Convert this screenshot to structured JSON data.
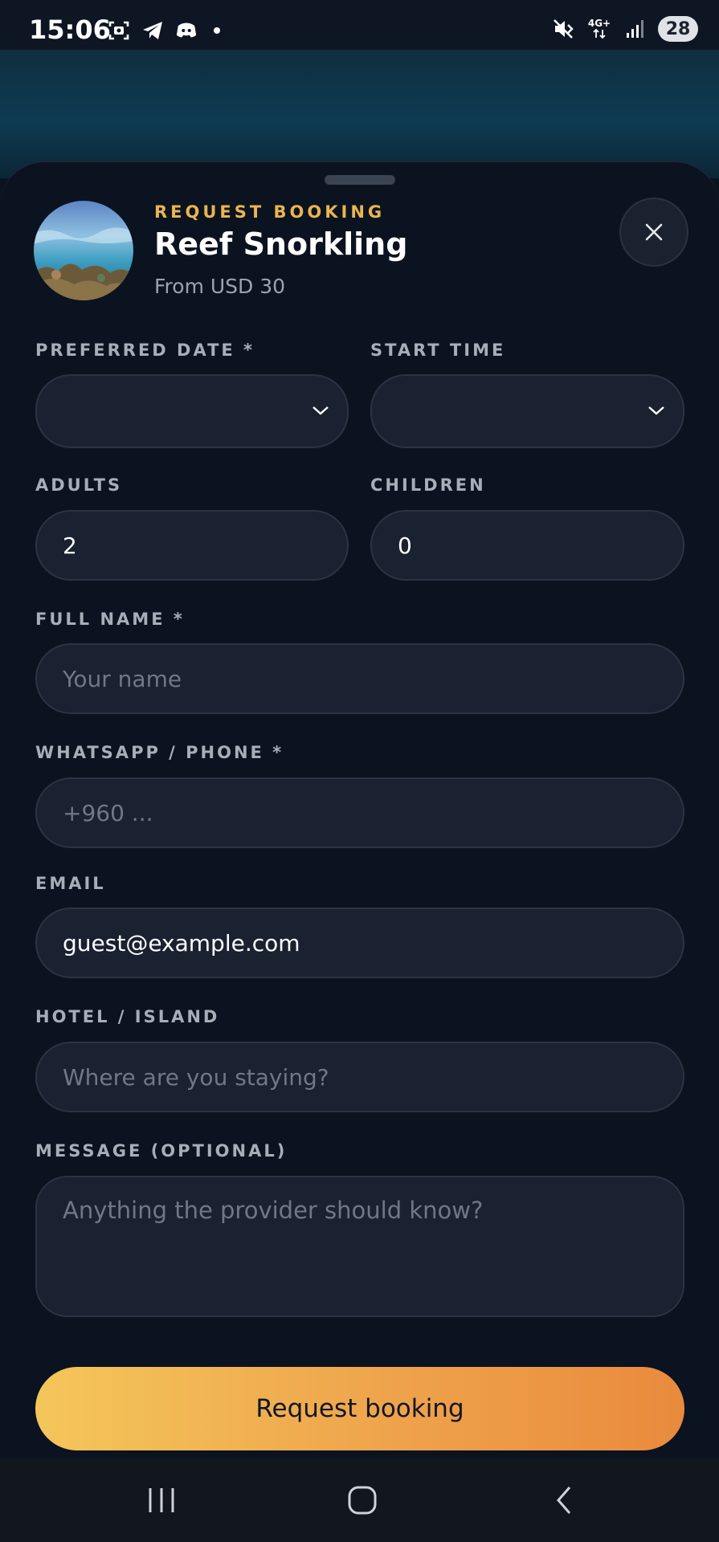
{
  "status_bar": {
    "time": "15:06",
    "network_label": "4G+",
    "battery": "28",
    "icons_left": [
      "screenshot-icon",
      "telegram-icon",
      "discord-icon",
      "dot-icon"
    ],
    "icons_right": [
      "mute-icon",
      "network-icon",
      "signal-icon",
      "battery-icon"
    ]
  },
  "header": {
    "eyebrow": "REQUEST BOOKING",
    "title": "Reef Snorkling",
    "subtitle": "From USD 30"
  },
  "form": {
    "date_label": "PREFERRED DATE *",
    "date_value": "",
    "time_label": "START TIME",
    "time_value": "",
    "adults_label": "ADULTS",
    "adults_value": "2",
    "children_label": "CHILDREN",
    "children_value": "0",
    "name_label": "FULL NAME *",
    "name_placeholder": "Your name",
    "phone_label": "WHATSAPP / PHONE *",
    "phone_placeholder": "+960 ...",
    "email_label": "EMAIL",
    "email_value": "guest@example.com",
    "hotel_label": "HOTEL / ISLAND",
    "hotel_placeholder": "Where are you staying?",
    "message_label": "MESSAGE (OPTIONAL)",
    "message_placeholder": "Anything the provider should know?"
  },
  "cta": {
    "label": "Request booking"
  },
  "colors": {
    "accent": "#e9b54f",
    "cta_start": "#f4c65a",
    "cta_end": "#e98a3c",
    "background": "#0c1320",
    "field": "#1a2130"
  }
}
